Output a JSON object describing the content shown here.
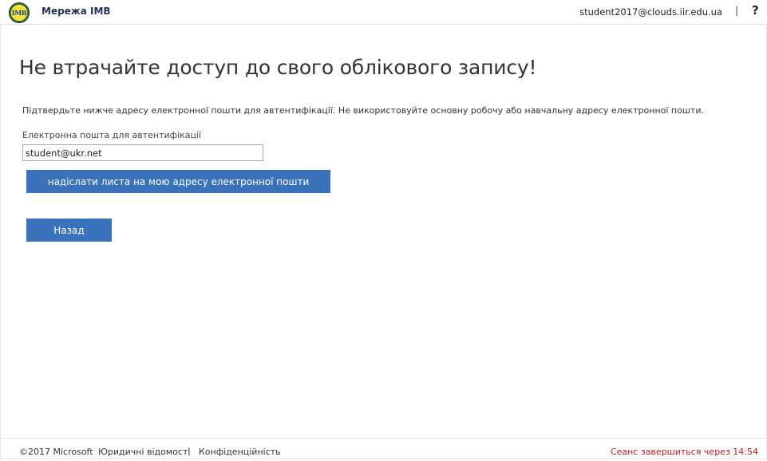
{
  "header": {
    "brand": "Мережа ІМВ",
    "logo_text": "IMB",
    "user_email": "student2017@clouds.iir.edu.ua",
    "separator": "|",
    "help_label": "?"
  },
  "main": {
    "title": "Не втрачайте доступ до свого облікового запису!",
    "instructions": "Підтвердьте нижче адресу електронної пошти для автентифікації. Не використовуйте основну робочу або навчальну адресу електронної пошти.",
    "field_label": "Електронна пошта для автентифікації",
    "email_value": "student@ukr.net",
    "send_button": "надіслати листа на мою адресу електронної пошти",
    "back_button": "Назад"
  },
  "footer": {
    "copyright": "©2017 Microsoft",
    "legal": "Юридичні відомості",
    "separator": "|",
    "privacy": "Конфіденційність",
    "session": "Сеанс завершиться через 14:54"
  },
  "colors": {
    "button": "#3a73bc",
    "session_text": "#b22222",
    "brand_text": "#1f3354"
  },
  "icons": {
    "logo": "imb-logo-icon",
    "help": "help-question-icon"
  }
}
